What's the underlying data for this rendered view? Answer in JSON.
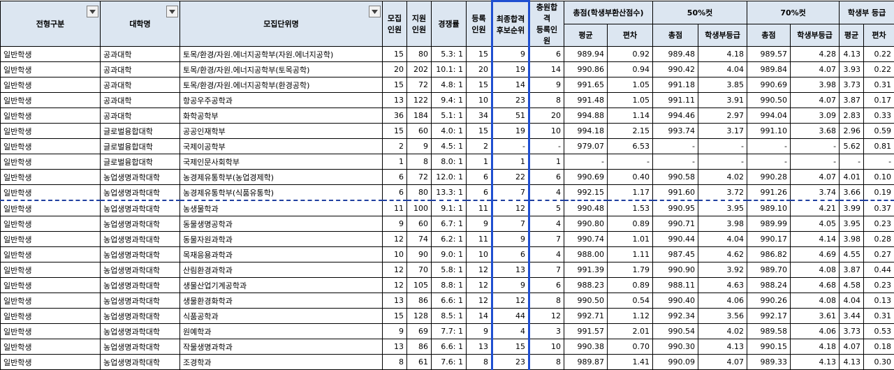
{
  "headers": {
    "track": "전형구분",
    "university": "대학명",
    "department": "모집단위명",
    "quota": "모집\n인원",
    "applicants": "지원\n인원",
    "ratio": "경쟁률",
    "registered": "등록\n인원",
    "final_waitlist": "최종합격\n후보순위",
    "charter_registered": "충원합격\n등록인원",
    "total_group": "총점(학생부환산점수)",
    "total_avg": "평균",
    "total_sd": "편차",
    "cut50_group": "50%컷",
    "cut50_total": "총점",
    "cut50_grade": "학생부등급",
    "cut70_group": "70%컷",
    "cut70_total": "총점",
    "cut70_grade": "학생부등급",
    "grade_group": "학생부 등급",
    "grade_avg": "평균",
    "grade_sd": "편차"
  },
  "rows": [
    [
      "일반학생",
      "공과대학",
      "토목/환경/자원.에너지공학부(자원.에너지공학)",
      "15",
      "80",
      "5.3: 1",
      "15",
      "9",
      "6",
      "989.94",
      "0.92",
      "989.48",
      "4.18",
      "989.57",
      "4.28",
      "4.13",
      "0.22"
    ],
    [
      "일반학생",
      "공과대학",
      "토목/환경/자원.에너지공학부(토목공학)",
      "20",
      "202",
      "10.1: 1",
      "20",
      "19",
      "14",
      "990.86",
      "0.94",
      "990.42",
      "4.04",
      "989.84",
      "4.07",
      "3.93",
      "0.22"
    ],
    [
      "일반학생",
      "공과대학",
      "토목/환경/자원.에너지공학부(환경공학)",
      "15",
      "72",
      "4.8: 1",
      "15",
      "14",
      "9",
      "991.65",
      "1.05",
      "991.18",
      "3.85",
      "990.69",
      "3.98",
      "3.73",
      "0.31"
    ],
    [
      "일반학생",
      "공과대학",
      "항공우주공학과",
      "13",
      "122",
      "9.4: 1",
      "10",
      "23",
      "8",
      "991.48",
      "1.05",
      "991.11",
      "3.91",
      "990.50",
      "4.07",
      "3.87",
      "0.17"
    ],
    [
      "일반학생",
      "공과대학",
      "화학공학부",
      "36",
      "184",
      "5.1: 1",
      "34",
      "51",
      "20",
      "994.88",
      "1.14",
      "994.46",
      "2.97",
      "994.04",
      "3.09",
      "2.83",
      "0.33"
    ],
    [
      "일반학생",
      "글로벌융합대학",
      "공공인재학부",
      "15",
      "60",
      "4.0: 1",
      "15",
      "19",
      "10",
      "994.18",
      "2.15",
      "993.74",
      "3.17",
      "991.10",
      "3.68",
      "2.96",
      "0.59"
    ],
    [
      "일반학생",
      "글로벌융합대학",
      "국제이공학부",
      "2",
      "9",
      "4.5: 1",
      "2",
      "-",
      "-",
      "979.07",
      "6.53",
      "-",
      "-",
      "-",
      "-",
      "5.62",
      "0.81"
    ],
    [
      "일반학생",
      "글로벌융합대학",
      "국제인문사회학부",
      "1",
      "8",
      "8.0: 1",
      "1",
      "1",
      "1",
      "-",
      "-",
      "-",
      "-",
      "-",
      "-",
      "-",
      "-"
    ],
    [
      "일반학생",
      "농업생명과학대학",
      "농경제유통학부(농업경제학)",
      "6",
      "72",
      "12.0: 1",
      "6",
      "22",
      "6",
      "990.69",
      "0.40",
      "990.58",
      "4.02",
      "990.28",
      "4.07",
      "4.01",
      "0.10"
    ],
    [
      "일반학생",
      "농업생명과학대학",
      "농경제유통학부(식품유통학)",
      "6",
      "80",
      "13.3: 1",
      "6",
      "7",
      "4",
      "992.15",
      "1.17",
      "991.60",
      "3.72",
      "991.26",
      "3.74",
      "3.66",
      "0.19"
    ],
    [
      "일반학생",
      "농업생명과학대학",
      "농생물학과",
      "11",
      "100",
      "9.1: 1",
      "11",
      "12",
      "5",
      "990.48",
      "1.53",
      "990.95",
      "3.95",
      "989.10",
      "4.21",
      "3.99",
      "0.37"
    ],
    [
      "일반학생",
      "농업생명과학대학",
      "동물생명공학과",
      "9",
      "60",
      "6.7: 1",
      "9",
      "7",
      "4",
      "990.80",
      "0.89",
      "990.71",
      "3.98",
      "989.99",
      "4.05",
      "3.95",
      "0.23"
    ],
    [
      "일반학생",
      "농업생명과학대학",
      "동물자원과학과",
      "12",
      "74",
      "6.2: 1",
      "11",
      "9",
      "7",
      "990.74",
      "1.01",
      "990.44",
      "4.04",
      "990.17",
      "4.14",
      "3.98",
      "0.28"
    ],
    [
      "일반학생",
      "농업생명과학대학",
      "목재응용과학과",
      "10",
      "90",
      "9.0: 1",
      "10",
      "6",
      "4",
      "988.00",
      "1.11",
      "987.45",
      "4.62",
      "986.82",
      "4.69",
      "4.55",
      "0.27"
    ],
    [
      "일반학생",
      "농업생명과학대학",
      "산림환경과학과",
      "12",
      "70",
      "5.8: 1",
      "12",
      "13",
      "7",
      "991.39",
      "1.79",
      "990.90",
      "3.92",
      "989.70",
      "4.08",
      "3.87",
      "0.44"
    ],
    [
      "일반학생",
      "농업생명과학대학",
      "생물산업기계공학과",
      "12",
      "105",
      "8.8: 1",
      "12",
      "9",
      "6",
      "988.23",
      "0.89",
      "988.11",
      "4.63",
      "988.24",
      "4.68",
      "4.58",
      "0.23"
    ],
    [
      "일반학생",
      "농업생명과학대학",
      "생물환경화학과",
      "13",
      "86",
      "6.6: 1",
      "12",
      "12",
      "8",
      "990.50",
      "0.54",
      "990.40",
      "4.06",
      "990.26",
      "4.08",
      "4.04",
      "0.13"
    ],
    [
      "일반학생",
      "농업생명과학대학",
      "식품공학과",
      "15",
      "128",
      "8.5: 1",
      "14",
      "44",
      "12",
      "992.71",
      "1.12",
      "992.34",
      "3.56",
      "992.17",
      "3.61",
      "3.44",
      "0.31"
    ],
    [
      "일반학생",
      "농업생명과학대학",
      "원예학과",
      "9",
      "69",
      "7.7: 1",
      "9",
      "4",
      "3",
      "991.57",
      "2.01",
      "990.54",
      "4.02",
      "989.58",
      "4.06",
      "3.73",
      "0.53"
    ],
    [
      "일반학생",
      "농업생명과학대학",
      "작물생명과학과",
      "13",
      "86",
      "6.6: 1",
      "13",
      "15",
      "10",
      "990.38",
      "0.70",
      "990.30",
      "4.13",
      "990.15",
      "4.18",
      "4.07",
      "0.18"
    ],
    [
      "일반학생",
      "농업생명과학대학",
      "조경학과",
      "8",
      "61",
      "7.6: 1",
      "8",
      "23",
      "8",
      "989.87",
      "1.41",
      "990.09",
      "4.07",
      "989.33",
      "4.13",
      "4.13",
      "0.30"
    ]
  ]
}
